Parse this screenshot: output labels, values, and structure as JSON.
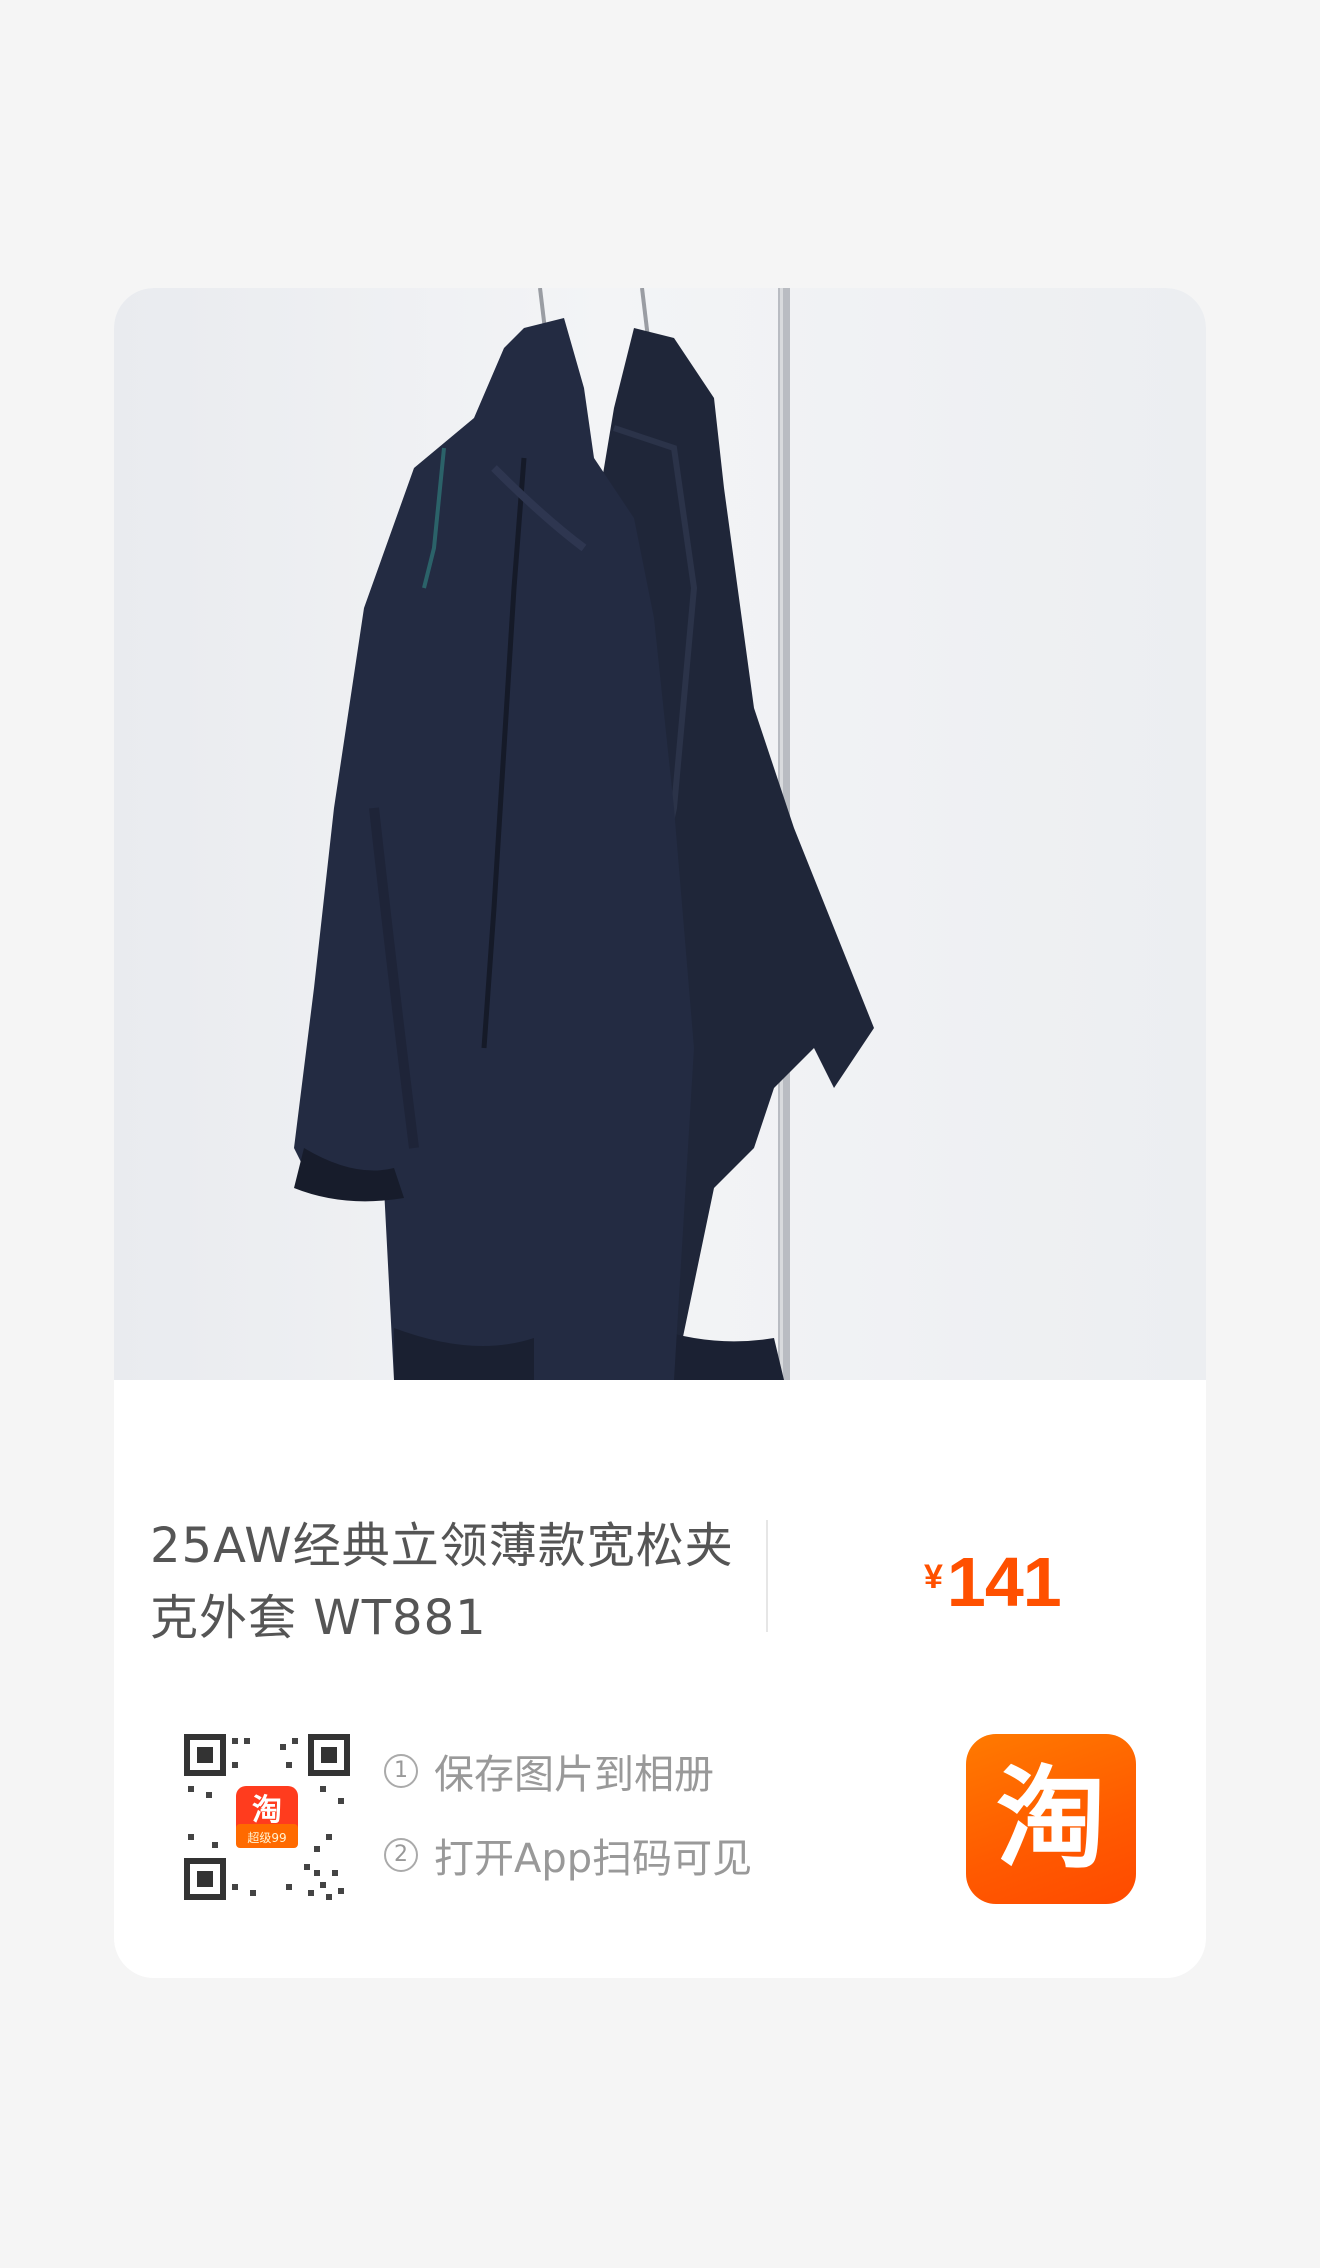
{
  "product": {
    "image_alt": "two navy jackets hanging on a rack",
    "title_line1": "25AW经典立领薄款宽松夹",
    "title_line2": "克外套 WT881",
    "price_currency": "¥",
    "price_value": "141"
  },
  "share": {
    "qr_badge_text": "淘",
    "qr_badge_subtext": "超级99",
    "steps": [
      {
        "number": "1",
        "text": "保存图片到相册"
      },
      {
        "number": "2",
        "text": "打开App扫码可见"
      }
    ],
    "logo_text": "淘"
  },
  "colors": {
    "price": "#ff5000",
    "title": "#555555",
    "steps": "#999999",
    "taobao_orange": "#ff5a00",
    "jacket_navy": "#20263a"
  }
}
